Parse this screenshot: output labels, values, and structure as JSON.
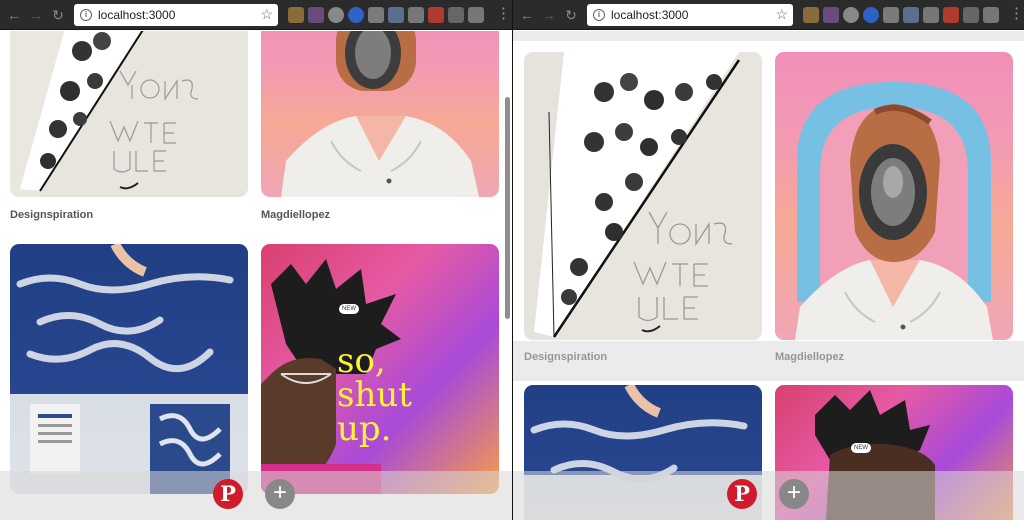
{
  "left_window": {
    "url": "localhost:3000",
    "cards": [
      {
        "caption": "Designspiration"
      },
      {
        "caption": "Magdiellopez"
      },
      {
        "caption": ""
      },
      {
        "caption": "",
        "poster_text": [
          "so,",
          "shut",
          "up."
        ],
        "pill": "NEW"
      }
    ],
    "actions": {
      "pin_glyph": "P",
      "add_glyph": "+"
    }
  },
  "right_window": {
    "url": "localhost:3000",
    "cards": [
      {
        "caption": "Designspiration"
      },
      {
        "caption": "Magdiellopez"
      },
      {
        "caption": ""
      },
      {
        "caption": "",
        "pill": "NEW"
      }
    ],
    "actions": {
      "pin_glyph": "P",
      "add_glyph": "+"
    }
  },
  "icons": {
    "back": "back-arrow-icon",
    "forward": "forward-arrow-icon",
    "reload": "reload-icon",
    "info": "info-icon",
    "star": "bookmark-star-icon",
    "menu": "menu-dots-icon"
  },
  "colors": {
    "pinterest_red": "#cf1b2b",
    "add_gray": "#888888",
    "poster_yellow": "#fff23a"
  }
}
